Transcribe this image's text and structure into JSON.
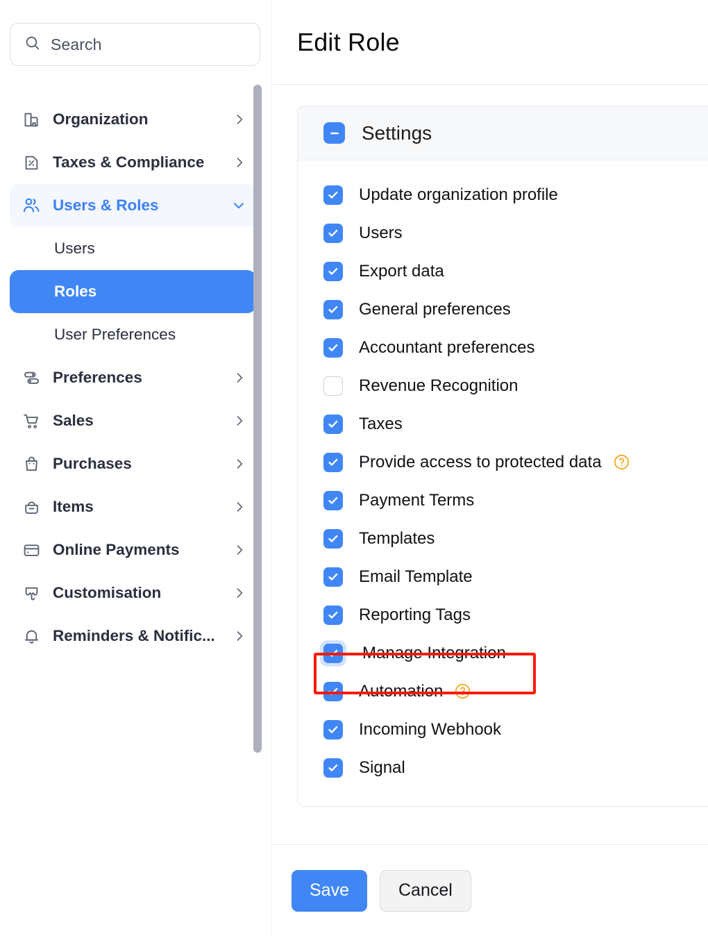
{
  "search": {
    "placeholder": "Search",
    "value": "",
    "icon": "search-icon"
  },
  "sidebar": {
    "items": [
      {
        "label": "Organization",
        "icon": "organization-icon",
        "chevron": "chevron-right",
        "state": "collapsed"
      },
      {
        "label": "Taxes & Compliance",
        "icon": "tax-document-icon",
        "chevron": "chevron-right",
        "state": "collapsed"
      },
      {
        "label": "Users & Roles",
        "icon": "users-icon",
        "chevron": "chevron-down",
        "state": "expanded"
      },
      {
        "label": "Preferences",
        "icon": "sliders-icon",
        "chevron": "chevron-right",
        "state": "collapsed"
      },
      {
        "label": "Sales",
        "icon": "cart-icon",
        "chevron": "chevron-right",
        "state": "collapsed"
      },
      {
        "label": "Purchases",
        "icon": "bag-icon",
        "chevron": "chevron-right",
        "state": "collapsed"
      },
      {
        "label": "Items",
        "icon": "basket-minus-icon",
        "chevron": "chevron-right",
        "state": "collapsed"
      },
      {
        "label": "Online Payments",
        "icon": "credit-card-icon",
        "chevron": "chevron-right",
        "state": "collapsed"
      },
      {
        "label": "Customisation",
        "icon": "palette-icon",
        "chevron": "chevron-right",
        "state": "collapsed"
      },
      {
        "label": "Reminders & Notific...",
        "icon": "bell-icon",
        "chevron": "chevron-right",
        "state": "collapsed"
      }
    ],
    "sub_items": [
      {
        "label": "Users",
        "selected": false
      },
      {
        "label": "Roles",
        "selected": true
      },
      {
        "label": "User Preferences",
        "selected": false
      }
    ],
    "accent_selected": "#4087f5",
    "accent_parent_bg": "#f4f7fd"
  },
  "header": {
    "title": "Edit Role"
  },
  "permissions": {
    "section_title": "Settings",
    "section_checkbox_state": "indeterminate",
    "rows": [
      {
        "label": "Update organization profile",
        "checked": true,
        "help": false,
        "highlighted": false
      },
      {
        "label": "Users",
        "checked": true,
        "help": false,
        "highlighted": false
      },
      {
        "label": "Export data",
        "checked": true,
        "help": false,
        "highlighted": false
      },
      {
        "label": "General preferences",
        "checked": true,
        "help": false,
        "highlighted": false
      },
      {
        "label": "Accountant preferences",
        "checked": true,
        "help": false,
        "highlighted": false
      },
      {
        "label": "Revenue Recognition",
        "checked": false,
        "help": false,
        "highlighted": false
      },
      {
        "label": "Taxes",
        "checked": true,
        "help": false,
        "highlighted": false
      },
      {
        "label": "Provide access to protected data",
        "checked": true,
        "help": true,
        "highlighted": false
      },
      {
        "label": "Payment Terms",
        "checked": true,
        "help": false,
        "highlighted": false
      },
      {
        "label": "Templates",
        "checked": true,
        "help": false,
        "highlighted": false
      },
      {
        "label": "Email Template",
        "checked": true,
        "help": false,
        "highlighted": false
      },
      {
        "label": "Reporting Tags",
        "checked": true,
        "help": false,
        "highlighted": false
      },
      {
        "label": "Manage Integration",
        "checked": true,
        "help": false,
        "highlighted": true
      },
      {
        "label": "Automation",
        "checked": true,
        "help": true,
        "highlighted": false
      },
      {
        "label": "Incoming Webhook",
        "checked": true,
        "help": false,
        "highlighted": false
      },
      {
        "label": "Signal",
        "checked": true,
        "help": false,
        "highlighted": false
      }
    ],
    "help_icon_color": "#f5a623",
    "checked_color": "#4087f5"
  },
  "footer": {
    "save_label": "Save",
    "cancel_label": "Cancel"
  },
  "annotation": {
    "color": "#f91b0b",
    "target": "Manage Integration"
  }
}
